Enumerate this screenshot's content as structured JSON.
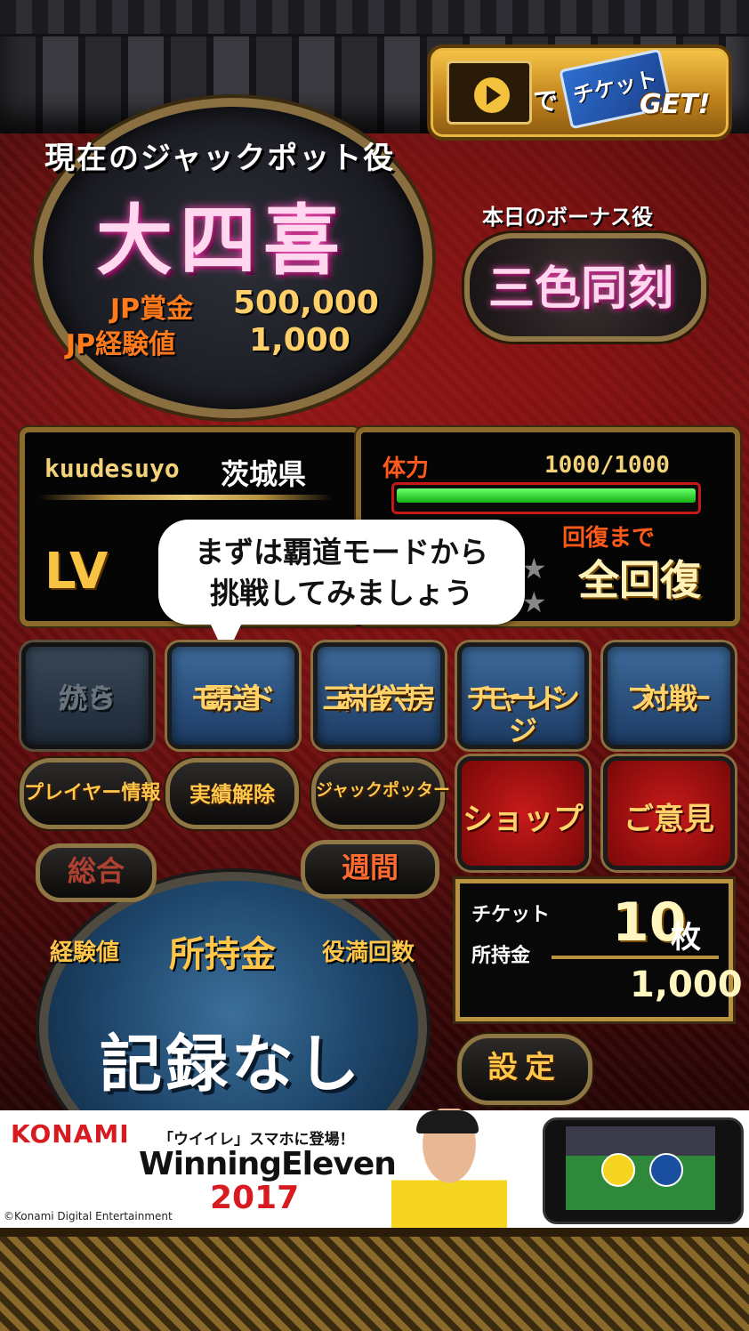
{
  "ticket_banner": {
    "de": "で",
    "ticket": "チケット",
    "get": "GET!"
  },
  "jackpot": {
    "title": "現在のジャックポット役",
    "yaku": "大四喜",
    "prize_label": "JP賞金",
    "prize_value": "500,000",
    "exp_label": "JP経験値",
    "exp_value": "1,000"
  },
  "bonus": {
    "title": "本日のボーナス役",
    "yaku": "三色同刻"
  },
  "player": {
    "name": "kuudesuyo",
    "prefecture": "茨城県",
    "level_label": "LV"
  },
  "stamina": {
    "label": "体力",
    "value": "1000/1000",
    "fill": 1.0,
    "recover_label": "回復まで",
    "recover_value": "全回復"
  },
  "tooltip": {
    "line1": "まずは覇道モードから",
    "line2": "挑戦してみましょう"
  },
  "modes": [
    {
      "line1": "続き",
      "line2": "から"
    },
    {
      "line1": "覇道",
      "line2": "モード"
    },
    {
      "line1": "麻雀寺",
      "line2": "三十六房"
    },
    {
      "line1": "チャレンジ",
      "line2": "モード"
    },
    {
      "line1": "フリー",
      "line2": "対戦"
    }
  ],
  "menu": {
    "player_info": "プレイヤー情報",
    "achievements": "実績解除",
    "jackpotter": "ジャックポッター",
    "shop": "ショップ",
    "feedback": "ご意見"
  },
  "ranking": {
    "tab_overall": "総合",
    "tab_weekly": "週間",
    "sub_exp": "経験値",
    "sub_money": "所持金",
    "sub_yakuman": "役満回数",
    "empty": "記録なし"
  },
  "wallet": {
    "ticket_label": "チケット",
    "ticket_count": "10",
    "ticket_unit": "枚",
    "money_label": "所持金",
    "money_value": "1,000"
  },
  "settings": "設定",
  "ad": {
    "brand": "KONAMI",
    "tagline": "「ウイイレ」スマホに登場！",
    "product": "WinningEleven",
    "year": "2017",
    "copyright": "©Konami Digital Entertainment"
  },
  "colors": {
    "accent_gold": "#8e7645",
    "mode_blue": "#3d6a9a",
    "shop_red": "#c81a1a"
  }
}
